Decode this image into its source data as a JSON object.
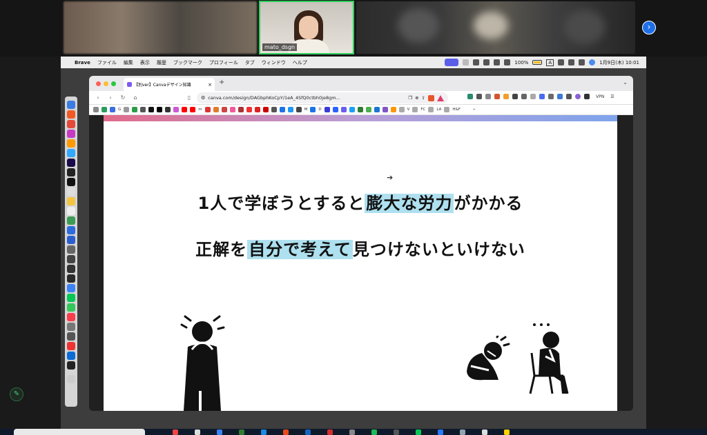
{
  "video": {
    "speaker_name": "mato_dsgn",
    "next_page_glyph": "›"
  },
  "menubar": {
    "apple": "",
    "app_name": "Brave",
    "items": [
      "ファイル",
      "編集",
      "表示",
      "履歴",
      "ブックマーク",
      "プロフィール",
      "タブ",
      "ウィンドウ",
      "ヘルプ"
    ],
    "battery": "100%",
    "input_mode": "A",
    "date_time": "1月9日(木) 10:01"
  },
  "browser": {
    "tab_title": "【別ver】Canvaデザイン知識",
    "tab_close": "×",
    "new_tab": "+",
    "url": "canva.com/design/DAGbphKoCpY/1eA_4SfQ0ctbh0je8gm...",
    "back": "‹",
    "forward": "›",
    "reload": "↻",
    "home": "⌂",
    "vpn_label": "VPN",
    "menu": "☰",
    "bookmarks_more": "»",
    "bookmark_labels": [
      "G",
      "m",
      "M",
      "D",
      "V",
      "FC",
      "LA",
      "H&F"
    ]
  },
  "slide": {
    "line1_pre": "1人で学ぼうとすると",
    "line1_highlight": "膨大な労力",
    "line1_post": "がかかる",
    "line2_pre": "正解を",
    "line2_highlight": "自分で考えて",
    "line2_post": "見つけないといけない",
    "cursor": "➔"
  },
  "colors": {
    "highlight": "#aee0ef",
    "speaker_border": "#2fd15c",
    "accent_blue": "#1e6fe8"
  }
}
